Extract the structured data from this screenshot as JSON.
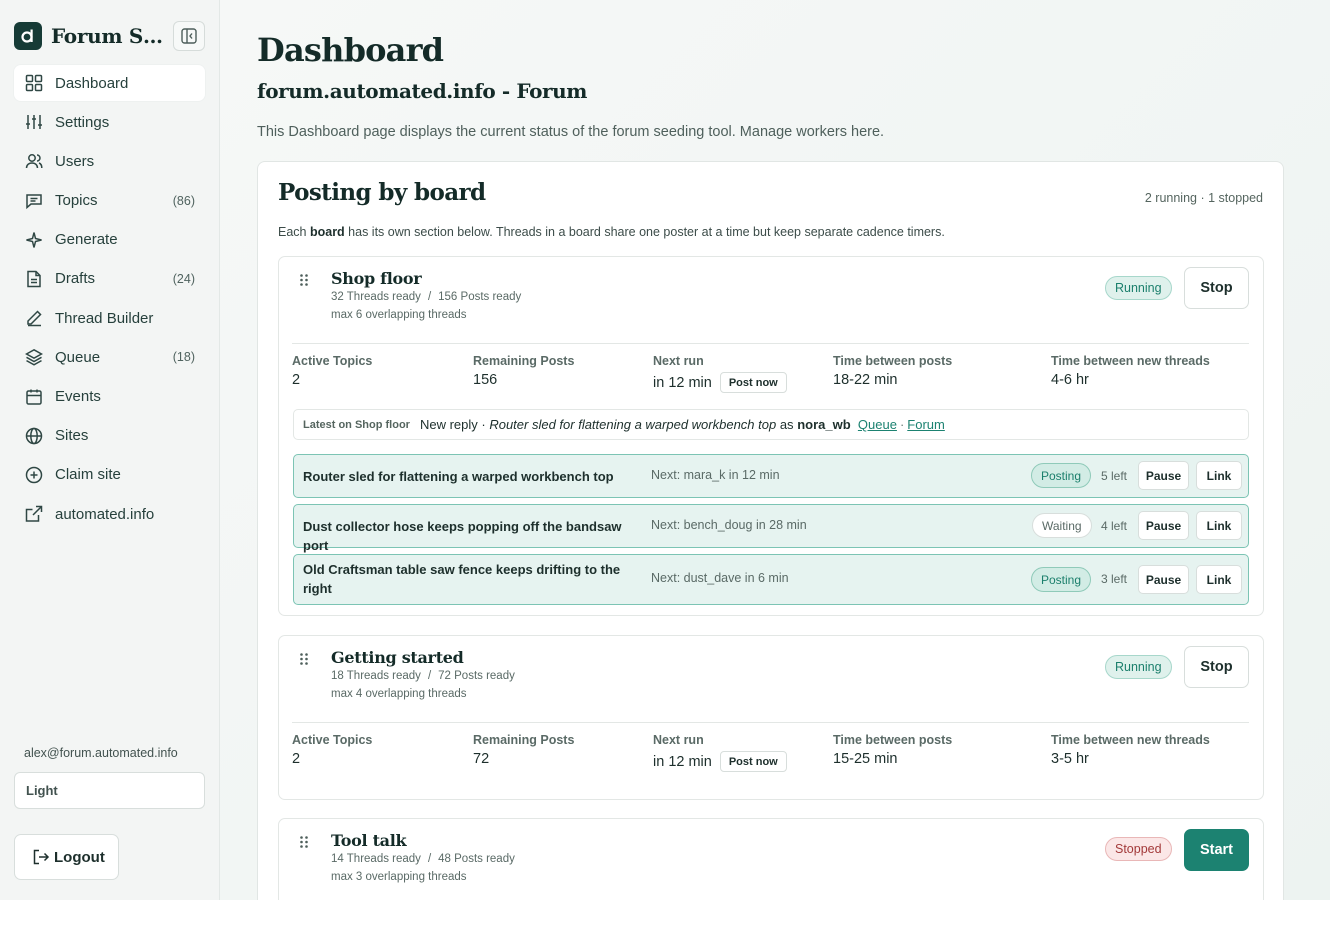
{
  "app": {
    "name": "Forum Se..."
  },
  "sidebar": {
    "items": [
      {
        "label": "Dashboard",
        "icon": "dashboard-grid-icon",
        "count": ""
      },
      {
        "label": "Settings",
        "icon": "sliders-icon",
        "count": ""
      },
      {
        "label": "Users",
        "icon": "users-icon",
        "count": ""
      },
      {
        "label": "Topics",
        "icon": "message-square-icon",
        "count": "(86)"
      },
      {
        "label": "Generate",
        "icon": "sparkle-icon",
        "count": ""
      },
      {
        "label": "Drafts",
        "icon": "file-icon",
        "count": "(24)"
      },
      {
        "label": "Thread Builder",
        "icon": "pencil-icon",
        "count": ""
      },
      {
        "label": "Queue",
        "icon": "layers-icon",
        "count": "(18)"
      },
      {
        "label": "Events",
        "icon": "calendar-icon",
        "count": ""
      },
      {
        "label": "Sites",
        "icon": "globe-icon",
        "count": ""
      },
      {
        "label": "Claim site",
        "icon": "plus-circle-icon",
        "count": ""
      },
      {
        "label": "automated.info",
        "icon": "external-link-icon",
        "count": ""
      }
    ],
    "user_email": "alex@forum.automated.info",
    "theme": "Light",
    "logout_label": "Logout"
  },
  "header": {
    "title": "Dashboard",
    "site": "forum.automated.info - Forum",
    "description": "This Dashboard page displays the current status of the forum seeding tool. Manage workers here."
  },
  "posting": {
    "title": "Posting by board",
    "status_summary": "2 running · 1 stopped",
    "desc_before": "Each ",
    "desc_bold": "board",
    "desc_after": " has its own section below. Threads in a board share one poster at a time but keep separate cadence timers.",
    "stat_labels": {
      "active": "Active Topics",
      "remaining": "Remaining Posts",
      "next": "Next run",
      "between_posts": "Time between posts",
      "between_threads": "Time between new threads",
      "post_now": "Post now"
    },
    "thread_buttons": {
      "pause": "Pause",
      "link": "Link"
    },
    "boards": [
      {
        "name": "Shop floor",
        "threads_ready": "32 Threads ready",
        "sep": "/",
        "posts_ready": "156 Posts ready",
        "max_overlap": "max 6 overlapping threads",
        "status": "Running",
        "action": "Stop",
        "active_topics": "2",
        "remaining_posts": "156",
        "next_run": "in 12 min",
        "between_posts": "18-22 min",
        "between_threads": "4-6 hr",
        "latest": {
          "label": "Latest on Shop floor",
          "prefix": "New reply · ",
          "thread": "Router sled for flattening a warped workbench top",
          "as": " as ",
          "user": "nora_wb",
          "queue_link": "Queue",
          "dot": "·",
          "forum_link": "Forum"
        },
        "threads": [
          {
            "title": "Router sled for flattening a warped workbench top",
            "next": "Next: mara_k in 12 min",
            "status": "Posting",
            "left": "5 left"
          },
          {
            "title": "Dust collector hose keeps popping off the bandsaw port",
            "next": "Next: bench_doug in 28 min",
            "status": "Waiting",
            "left": "4 left"
          },
          {
            "title": "Old Craftsman table saw fence keeps drifting to the right",
            "next": "Next: dust_dave in 6 min",
            "status": "Posting",
            "left": "3 left"
          }
        ]
      },
      {
        "name": "Getting started",
        "threads_ready": "18 Threads ready",
        "sep": "/",
        "posts_ready": "72 Posts ready",
        "max_overlap": "max 4 overlapping threads",
        "status": "Running",
        "action": "Stop",
        "active_topics": "2",
        "remaining_posts": "72",
        "next_run": "in 12 min",
        "between_posts": "15-25 min",
        "between_threads": "3-5 hr"
      },
      {
        "name": "Tool talk",
        "threads_ready": "14 Threads ready",
        "sep": "/",
        "posts_ready": "48 Posts ready",
        "max_overlap": "max 3 overlapping threads",
        "status": "Stopped",
        "action": "Start"
      }
    ]
  },
  "colors": {
    "accent": "#1c8271",
    "running_bg": "#dff1ec",
    "stopped_bg": "#fbe7e7",
    "thread_bg": "#e6f3f0"
  }
}
